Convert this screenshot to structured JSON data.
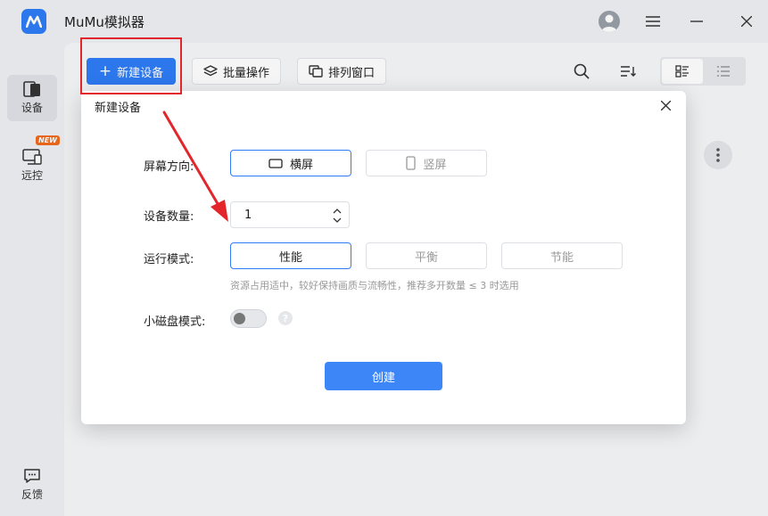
{
  "window": {
    "title": "MuMu模拟器"
  },
  "sidebar": {
    "items": [
      {
        "label": "设备",
        "icon": "device-icon",
        "active": true
      },
      {
        "label": "远控",
        "icon": "remote-icon",
        "badge": "NEW"
      },
      {
        "label": "反馈",
        "icon": "feedback-icon"
      }
    ]
  },
  "toolbar": {
    "new_device": "新建设备",
    "batch": "批量操作",
    "arrange": "排列窗口"
  },
  "dialog": {
    "title": "新建设备",
    "orientation": {
      "label": "屏幕方向:",
      "options": [
        "横屏",
        "竖屏"
      ],
      "selected": "横屏"
    },
    "count": {
      "label": "设备数量:",
      "value": "1"
    },
    "mode": {
      "label": "运行模式:",
      "options": [
        "性能",
        "平衡",
        "节能"
      ],
      "selected": "性能",
      "hint": "资源占用适中，较好保持画质与流畅性，推荐多开数量 ≤ 3 时选用"
    },
    "small_disk": {
      "label": "小磁盘模式:",
      "enabled": false
    },
    "create": "创建"
  },
  "colors": {
    "accent": "#2f7cf6",
    "annotation": "#e3262c",
    "new_badge": "#f26b1d"
  }
}
